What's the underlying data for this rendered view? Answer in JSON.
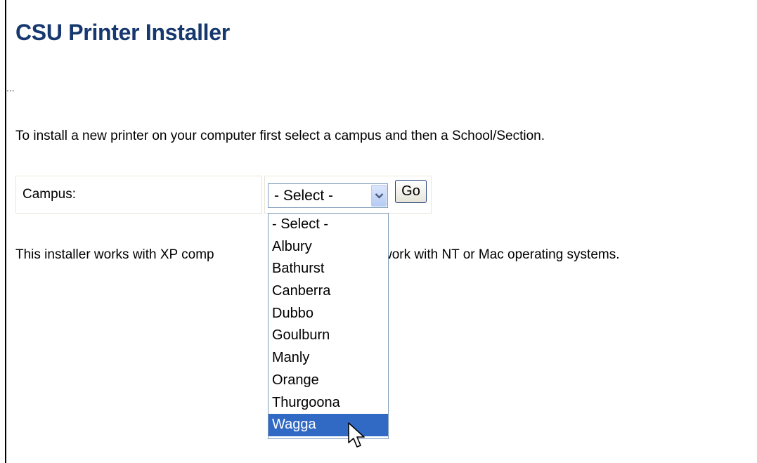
{
  "page": {
    "title": "CSU Printer Installer",
    "ellipsis": "...",
    "intro": "To install a new printer on your computer first select a campus and then a School/Section.",
    "note_before": "This installer works with XP comp",
    "note_after": "will not work with NT or Mac operating systems."
  },
  "form": {
    "campus_label": "Campus:",
    "select_value": "- Select -",
    "go_label": "Go",
    "options": [
      "- Select -",
      "Albury",
      "Bathurst",
      "Canberra",
      "Dubbo",
      "Goulburn",
      "Manly",
      "Orange",
      "Thurgoona",
      "Wagga"
    ],
    "highlighted_option": "Wagga"
  },
  "colors": {
    "title": "#16386e",
    "highlight": "#316ac5",
    "border": "#7f9db9"
  },
  "icons": {
    "dropdown_arrow": "chevron-down-icon",
    "cursor": "mouse-pointer-icon"
  }
}
